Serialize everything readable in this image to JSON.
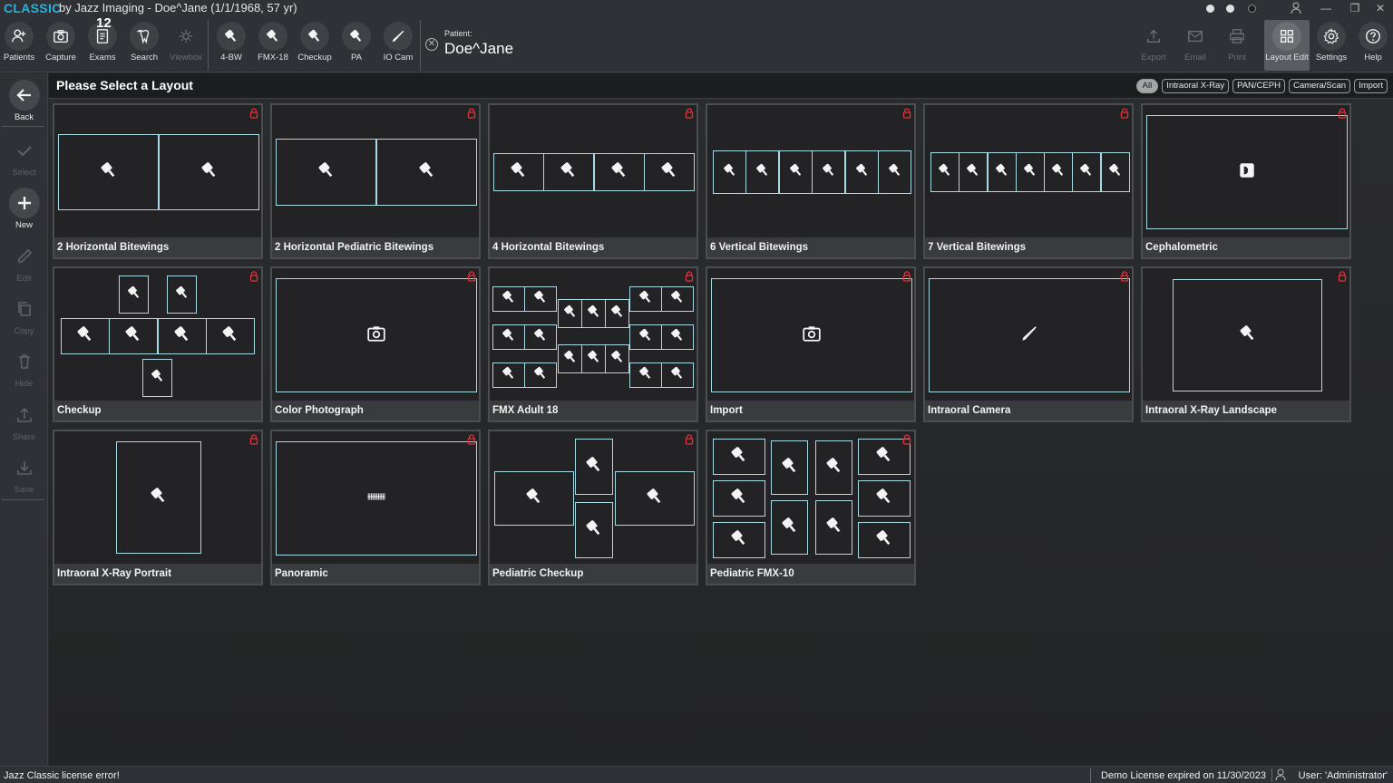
{
  "app": {
    "brand": "CLASSIC",
    "window_title": "by Jazz Imaging - Doe^Jane (1/1/1968, 57 yr)"
  },
  "toolbar": {
    "left": [
      {
        "label": "Patients",
        "icon": "add-user-icon"
      },
      {
        "label": "Capture",
        "icon": "camera-icon"
      },
      {
        "label": "Exams",
        "icon": "exams-icon",
        "badge": "12"
      },
      {
        "label": "Search",
        "icon": "tooth-icon"
      },
      {
        "label": "Viewbox",
        "icon": "sun-icon",
        "disabled": true
      },
      {
        "label": "4-BW",
        "icon": "xray-sensor-icon"
      },
      {
        "label": "FMX-18",
        "icon": "xray-sensor-icon"
      },
      {
        "label": "Checkup",
        "icon": "xray-sensor-icon"
      },
      {
        "label": "PA",
        "icon": "xray-sensor-icon"
      },
      {
        "label": "IO Cam",
        "icon": "intraoral-camera-icon"
      }
    ],
    "patient_caption": "Patient:",
    "patient_name": "Doe^Jane",
    "right": [
      {
        "label": "Export",
        "icon": "export-icon",
        "disabled": true
      },
      {
        "label": "Email",
        "icon": "email-icon",
        "disabled": true
      },
      {
        "label": "Print",
        "icon": "print-icon",
        "disabled": true
      },
      {
        "label": "Layout Edit",
        "icon": "layout-grid-icon",
        "active": true
      },
      {
        "label": "Settings",
        "icon": "gear-icon"
      },
      {
        "label": "Help",
        "icon": "help-icon"
      }
    ]
  },
  "sidebar": {
    "items": [
      {
        "label": "Back",
        "icon": "arrow-left-icon"
      },
      {
        "label": "Select",
        "icon": "checkmark-icon",
        "disabled": true
      },
      {
        "label": "New",
        "icon": "plus-icon"
      },
      {
        "label": "Edit",
        "icon": "pencil-icon",
        "disabled": true
      },
      {
        "label": "Copy",
        "icon": "copy-icon",
        "disabled": true
      },
      {
        "label": "Hide",
        "icon": "trash-icon",
        "disabled": true
      },
      {
        "label": "Share",
        "icon": "upload-icon",
        "disabled": true
      },
      {
        "label": "Save",
        "icon": "download-icon",
        "disabled": true
      }
    ]
  },
  "main": {
    "title": "Please Select a Layout",
    "filters": [
      {
        "label": "All",
        "active": true
      },
      {
        "label": "Intraoral X-Ray"
      },
      {
        "label": "PAN/CEPH"
      },
      {
        "label": "Camera/Scan"
      },
      {
        "label": "Import"
      }
    ],
    "layouts": [
      {
        "label": "2 Horizontal Bitewings"
      },
      {
        "label": "2 Horizontal Pediatric Bitewings"
      },
      {
        "label": "4 Horizontal Bitewings"
      },
      {
        "label": "6 Vertical Bitewings"
      },
      {
        "label": "7 Vertical Bitewings"
      },
      {
        "label": "Cephalometric"
      },
      {
        "label": "Checkup"
      },
      {
        "label": "Color Photograph"
      },
      {
        "label": "FMX Adult 18"
      },
      {
        "label": "Import"
      },
      {
        "label": "Intraoral Camera"
      },
      {
        "label": "Intraoral X-Ray Landscape"
      },
      {
        "label": "Intraoral X-Ray Portrait"
      },
      {
        "label": "Panoramic"
      },
      {
        "label": "Pediatric Checkup"
      },
      {
        "label": "Pediatric FMX-10"
      }
    ]
  },
  "status": {
    "left": "Jazz Classic license error!",
    "license": "Demo License expired on 11/30/2023",
    "user": "User: 'Administrator'"
  },
  "colors": {
    "accent": "#23b5e0",
    "slot_border": "#a9dbe5",
    "lock": "#e0303a"
  }
}
